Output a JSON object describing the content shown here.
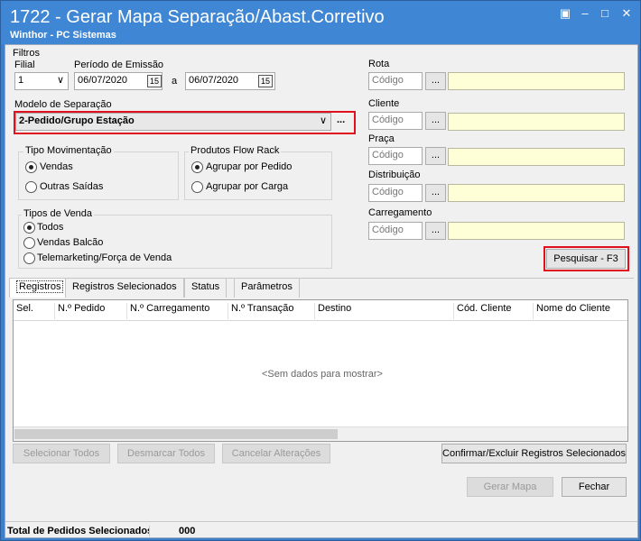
{
  "window": {
    "title": "1722 - Gerar Mapa Separação/Abast.Corretivo",
    "subtitle": "Winthor - PC Sistemas"
  },
  "filters": {
    "group_label": "Filtros",
    "filial": {
      "label": "Filial",
      "value": "1"
    },
    "periodo": {
      "label": "Período de Emissão",
      "start": "06/07/2020",
      "separator": "a",
      "end": "06/07/2020",
      "cal_icon": "15"
    },
    "modelo": {
      "label": "Modelo de Separação",
      "value": "2-Pedido/Grupo Estação",
      "more": "..."
    },
    "tipo_mov": {
      "label": "Tipo Movimentação",
      "options": [
        "Vendas",
        "Outras Saídas"
      ],
      "selected": 0
    },
    "flow_rack": {
      "label": "Produtos Flow Rack",
      "options": [
        "Agrupar por Pedido",
        "Agrupar por Carga"
      ],
      "selected": 0
    },
    "tipos_venda": {
      "label": "Tipos de Venda",
      "options": [
        "Todos",
        "Vendas Balcão",
        "Telemarketing/Força de  Venda"
      ],
      "selected": 0
    }
  },
  "lookups": [
    {
      "label": "Rota",
      "placeholder": "Código",
      "more": "..."
    },
    {
      "label": "Cliente",
      "placeholder": "Código",
      "more": "..."
    },
    {
      "label": "Praça",
      "placeholder": "Código",
      "more": "..."
    },
    {
      "label": "Distribuição",
      "placeholder": "Código",
      "more": "..."
    },
    {
      "label": "Carregamento",
      "placeholder": "Código",
      "more": "..."
    }
  ],
  "search_button": "Pesquisar - F3",
  "tabs": [
    "Registros",
    "Registros Selecionados",
    "Status",
    "Parâmetros"
  ],
  "grid": {
    "columns": [
      "Sel.",
      "N.º Pedido",
      "N.º Carregamento",
      "N.º Transação",
      "Destino",
      "Cód. Cliente",
      "Nome do Cliente"
    ],
    "empty_text": "<Sem dados para mostrar>"
  },
  "actions": {
    "select_all": "Selecionar Todos",
    "deselect_all": "Desmarcar Todos",
    "cancel_changes": "Cancelar Alterações",
    "confirm_delete": "Confirmar/Excluir Registros Selecionados",
    "generate_map": "Gerar Mapa",
    "close": "Fechar"
  },
  "status": {
    "label": "Total de Pedidos Selecionados",
    "value": "000"
  },
  "colors": {
    "titlebar": "#3f86d4",
    "highlight": "#e0101f",
    "lookup_fill": "#ffffd7"
  }
}
